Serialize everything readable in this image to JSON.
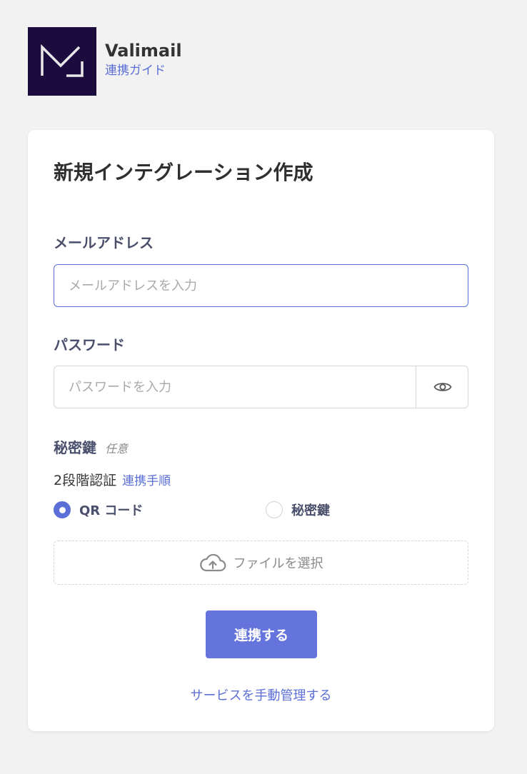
{
  "header": {
    "brand_name": "Valimail",
    "guide_link": "連携ガイド"
  },
  "form": {
    "title": "新規インテグレーション作成",
    "email": {
      "label": "メールアドレス",
      "placeholder": "メールアドレスを入力",
      "value": ""
    },
    "password": {
      "label": "パスワード",
      "placeholder": "パスワードを入力",
      "value": ""
    },
    "secret_key": {
      "label": "秘密鍵",
      "optional_tag": "任意"
    },
    "two_factor": {
      "label": "2段階認証",
      "link": "連携手順",
      "options": [
        {
          "label": "QR コード",
          "selected": true
        },
        {
          "label": "秘密鍵",
          "selected": false
        }
      ]
    },
    "upload": {
      "label": "ファイルを選択"
    },
    "submit_label": "連携する",
    "manual_link": "サービスを手動管理する"
  },
  "colors": {
    "accent": "#5b6fd6",
    "button": "#6474dc",
    "logo_bg": "#1c0c3d"
  },
  "icons": {
    "password_toggle": "eye-icon",
    "upload": "cloud-upload-icon"
  }
}
